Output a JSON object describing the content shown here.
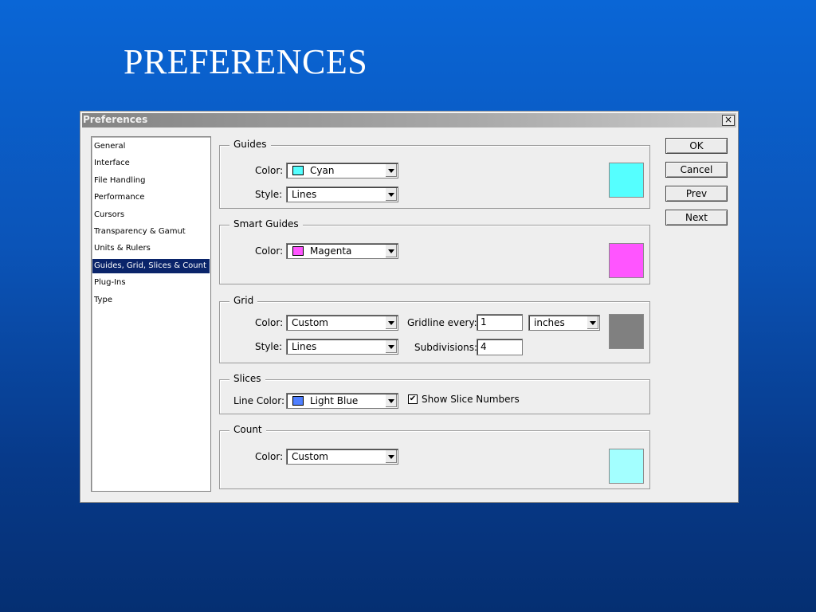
{
  "slide": {
    "title": "PREFERENCES"
  },
  "dialog": {
    "title": "Preferences",
    "close_glyph": "×"
  },
  "sidebar": {
    "items": [
      {
        "label": "General"
      },
      {
        "label": "Interface"
      },
      {
        "label": "File Handling"
      },
      {
        "label": "Performance"
      },
      {
        "label": "Cursors"
      },
      {
        "label": "Transparency & Gamut"
      },
      {
        "label": "Units & Rulers"
      },
      {
        "label": "Guides, Grid, Slices & Count"
      },
      {
        "label": "Plug-Ins"
      },
      {
        "label": "Type"
      }
    ],
    "selected": "Guides, Grid, Slices & Count"
  },
  "guides": {
    "legend": "Guides",
    "color_label": "Color:",
    "color_value": "Cyan",
    "color_hex": "#55ffff",
    "style_label": "Style:",
    "style_value": "Lines"
  },
  "smart_guides": {
    "legend": "Smart Guides",
    "color_label": "Color:",
    "color_value": "Magenta",
    "color_hex": "#ff55ff"
  },
  "grid": {
    "legend": "Grid",
    "color_label": "Color:",
    "color_value": "Custom",
    "color_hex": "#808080",
    "style_label": "Style:",
    "style_value": "Lines",
    "gridline_label": "Gridline every:",
    "gridline_value": "1",
    "gridline_unit": "inches",
    "subdivisions_label": "Subdivisions:",
    "subdivisions_value": "4"
  },
  "slices": {
    "legend": "Slices",
    "line_color_label": "Line Color:",
    "line_color_value": "Light Blue",
    "line_color_hex": "#4f7fff",
    "show_numbers_label": "Show Slice Numbers",
    "show_numbers_checked": true
  },
  "count": {
    "legend": "Count",
    "color_label": "Color:",
    "color_value": "Custom",
    "color_hex": "#a3ffff"
  },
  "buttons": {
    "ok": "OK",
    "cancel": "Cancel",
    "prev": "Prev",
    "next": "Next"
  }
}
